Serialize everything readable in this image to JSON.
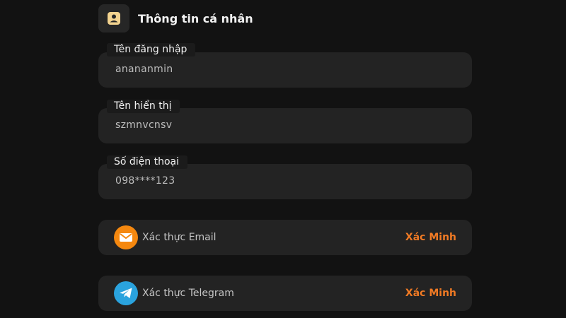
{
  "section": {
    "title": "Thông tin cá nhân",
    "icon": "profile-card-icon"
  },
  "fields": [
    {
      "label": "Tên đăng nhập",
      "value": "anananmin"
    },
    {
      "label": "Tên hiển thị",
      "value": "szmnvcnsv"
    },
    {
      "label": "Số điện thoại",
      "value": "098****123"
    }
  ],
  "verifications": [
    {
      "label": "Xác thực Email",
      "action": "Xác Minh",
      "icon": "email-icon",
      "icon_color": "#f5880f"
    },
    {
      "label": "Xác thực Telegram",
      "action": "Xác Minh",
      "icon": "telegram-icon",
      "icon_color": "#2aa3de"
    }
  ],
  "colors": {
    "background": "#121212",
    "card": "#232323",
    "accent": "#f07a24"
  }
}
